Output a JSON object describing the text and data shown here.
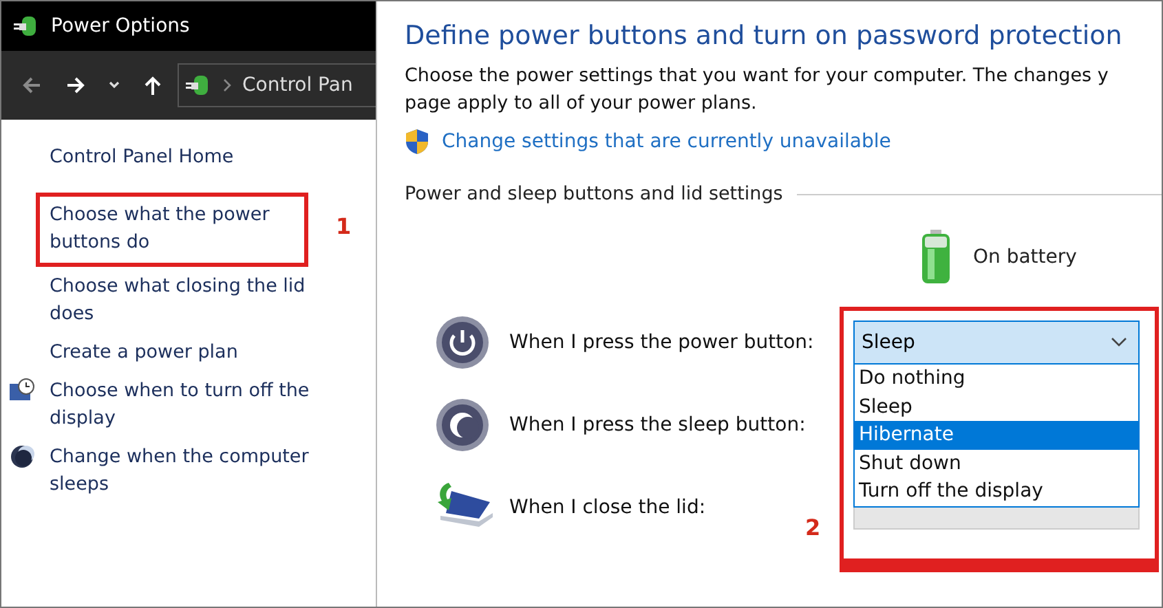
{
  "window": {
    "title": "Power Options"
  },
  "nav": {
    "breadcrumb": "Control Pan"
  },
  "sidebar": {
    "items": [
      {
        "label": "Control Panel Home",
        "kind": "plain"
      },
      {
        "label": "Choose what the power buttons do",
        "kind": "plain"
      },
      {
        "label": "Choose what closing the lid does",
        "kind": "plain"
      },
      {
        "label": "Create a power plan",
        "kind": "plain"
      },
      {
        "label": "Choose when to turn off the display",
        "kind": "display"
      },
      {
        "label": "Change when the computer sleeps",
        "kind": "sleep"
      }
    ]
  },
  "content": {
    "heading": "Define power buttons and turn on password protection",
    "description": [
      "Choose the power settings that you want for your computer. The changes y",
      "page apply to all of your power plans."
    ],
    "admin_link": "Change settings that are currently unavailable",
    "section": "Power and sleep buttons and lid settings",
    "column": "On battery",
    "rows": [
      {
        "kind": "power",
        "label": "When I press the power button:",
        "value": "Sleep",
        "expanded": true
      },
      {
        "kind": "sleep",
        "label": "When I press the sleep button:",
        "hidden": true
      },
      {
        "kind": "lid",
        "label": "When I close the lid:",
        "hidden": false
      }
    ],
    "options": [
      {
        "label": "Do nothing",
        "selected": false
      },
      {
        "label": "Sleep",
        "selected": false
      },
      {
        "label": "Hibernate",
        "selected": true
      },
      {
        "label": "Shut down",
        "selected": false
      },
      {
        "label": "Turn off the display",
        "selected": false
      }
    ]
  },
  "annotations": [
    {
      "label": "1"
    },
    {
      "label": "2"
    }
  ]
}
